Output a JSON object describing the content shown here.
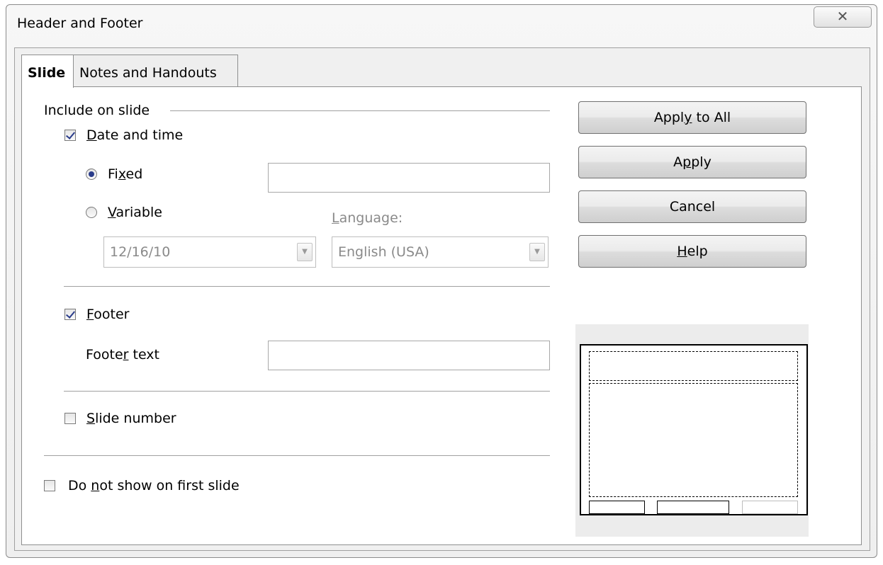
{
  "window": {
    "title": "Header and Footer",
    "close_glyph": "✕"
  },
  "tabs": [
    {
      "label": "Slide",
      "active": true
    },
    {
      "label": "Notes and Handouts",
      "active": false
    }
  ],
  "include": {
    "group_label": "Include on slide",
    "date_time": {
      "label_pre": "",
      "mnemonic": "D",
      "label_post": "ate and time",
      "checked": true
    },
    "fixed": {
      "label_pre": "Fi",
      "mnemonic": "x",
      "label_post": "ed",
      "selected": true,
      "value": ""
    },
    "variable": {
      "label_pre": "",
      "mnemonic": "V",
      "label_post": "ariable",
      "selected": false
    },
    "language_label": {
      "pre": "",
      "mnemonic": "L",
      "post": "anguage:"
    },
    "date_format_value": "12/16/10",
    "language_value": "English (USA)",
    "footer": {
      "label_pre": "",
      "mnemonic": "F",
      "label_post": "ooter",
      "checked": true
    },
    "footer_text": {
      "label_pre": "Foote",
      "mnemonic": "r",
      "label_post": " text",
      "value": ""
    },
    "slide_number": {
      "label_pre": "",
      "mnemonic": "S",
      "label_post": "lide number",
      "checked": false
    }
  },
  "not_first": {
    "label_pre": "Do ",
    "mnemonic": "n",
    "label_post": "ot show on first slide",
    "checked": false
  },
  "buttons": {
    "apply_all": {
      "pre": "Appl",
      "mnemonic": "y",
      "post": " to All"
    },
    "apply": {
      "pre": "A",
      "mnemonic": "p",
      "post": "ply"
    },
    "cancel": {
      "pre": "Cancel",
      "mnemonic": "",
      "post": ""
    },
    "help": {
      "pre": "",
      "mnemonic": "H",
      "post": "elp"
    }
  },
  "icons": {
    "close": "close-icon",
    "dropdown": "chevron-down-icon"
  },
  "colors": {
    "check_mark": "#2a3c8a",
    "disabled_text": "#8a8a8a"
  }
}
